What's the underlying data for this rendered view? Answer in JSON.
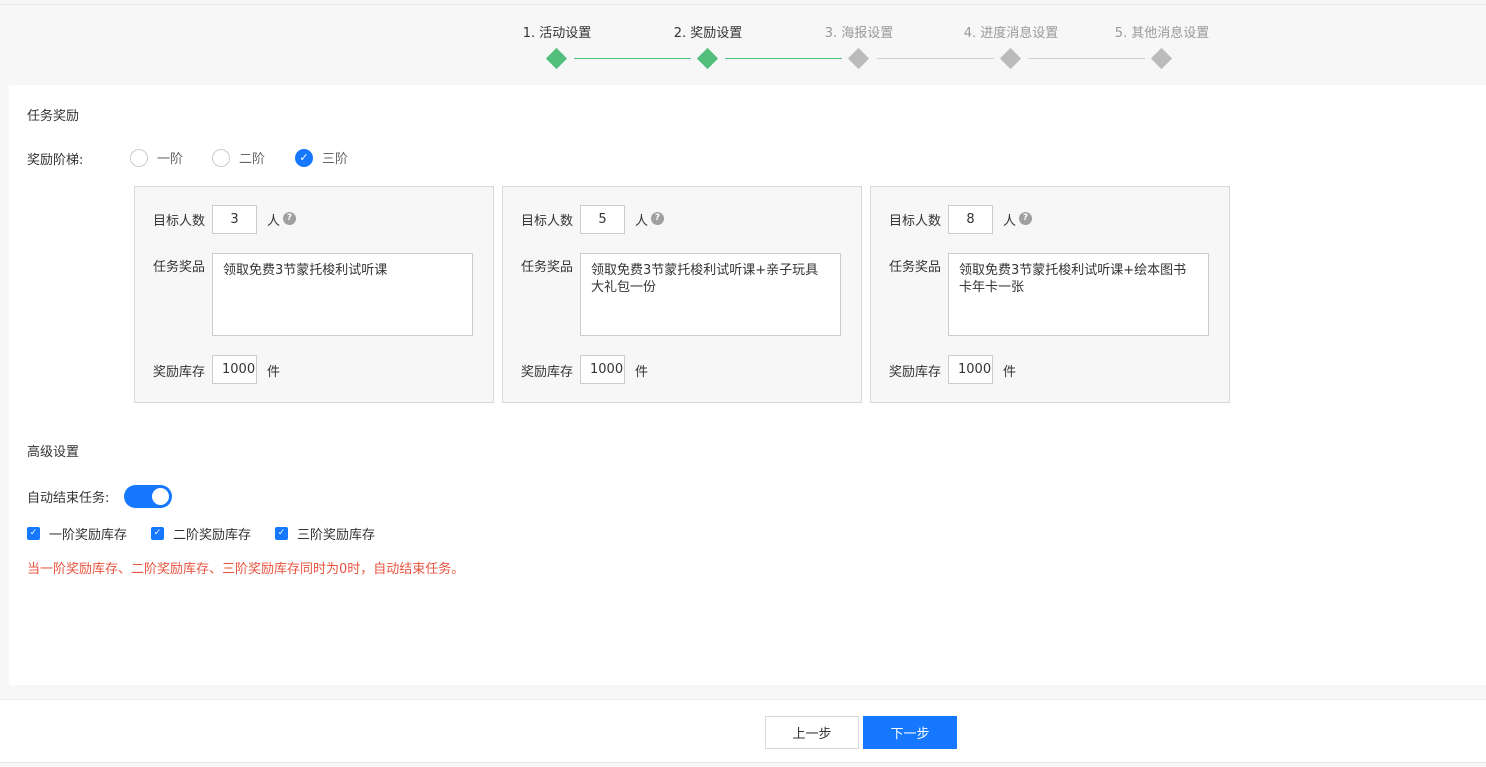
{
  "steps": [
    {
      "label": "1. 活动设置",
      "status": "done"
    },
    {
      "label": "2. 奖励设置",
      "status": "done"
    },
    {
      "label": "3. 海报设置",
      "status": "pending"
    },
    {
      "label": "4. 进度消息设置",
      "status": "pending"
    },
    {
      "label": "5. 其他消息设置",
      "status": "pending"
    }
  ],
  "task_reward": {
    "title": "任务奖励",
    "tier_label": "奖励阶梯:",
    "tier_options": [
      {
        "label": "一阶",
        "checked": false
      },
      {
        "label": "二阶",
        "checked": false
      },
      {
        "label": "三阶",
        "checked": true
      }
    ],
    "tiers": [
      {
        "target_label": "目标人数",
        "target_value": "3",
        "target_unit": "人",
        "prize_label": "任务奖品",
        "prize_value": "领取免费3节蒙托梭利试听课",
        "stock_label": "奖励库存",
        "stock_value": "1000",
        "stock_unit": "件"
      },
      {
        "target_label": "目标人数",
        "target_value": "5",
        "target_unit": "人",
        "prize_label": "任务奖品",
        "prize_value": "领取免费3节蒙托梭利试听课+亲子玩具大礼包一份",
        "stock_label": "奖励库存",
        "stock_value": "1000",
        "stock_unit": "件"
      },
      {
        "target_label": "目标人数",
        "target_value": "8",
        "target_unit": "人",
        "prize_label": "任务奖品",
        "prize_value": "领取免费3节蒙托梭利试听课+绘本图书卡年卡一张",
        "stock_label": "奖励库存",
        "stock_value": "1000",
        "stock_unit": "件"
      }
    ]
  },
  "advanced": {
    "title": "高级设置",
    "auto_end_label": "自动结束任务:",
    "auto_end_enabled": true,
    "checkboxes": [
      {
        "label": "一阶奖励库存",
        "checked": true
      },
      {
        "label": "二阶奖励库存",
        "checked": true
      },
      {
        "label": "三阶奖励库存",
        "checked": true
      }
    ],
    "warning": "当一阶奖励库存、二阶奖励库存、三阶奖励库存同时为0时，自动结束任务。"
  },
  "footer": {
    "prev_label": "上一步",
    "next_label": "下一步"
  },
  "colors": {
    "accent": "#1677ff",
    "step_done": "#52c07c",
    "step_pending": "#bbbbbb",
    "warning": "#e8533f"
  }
}
